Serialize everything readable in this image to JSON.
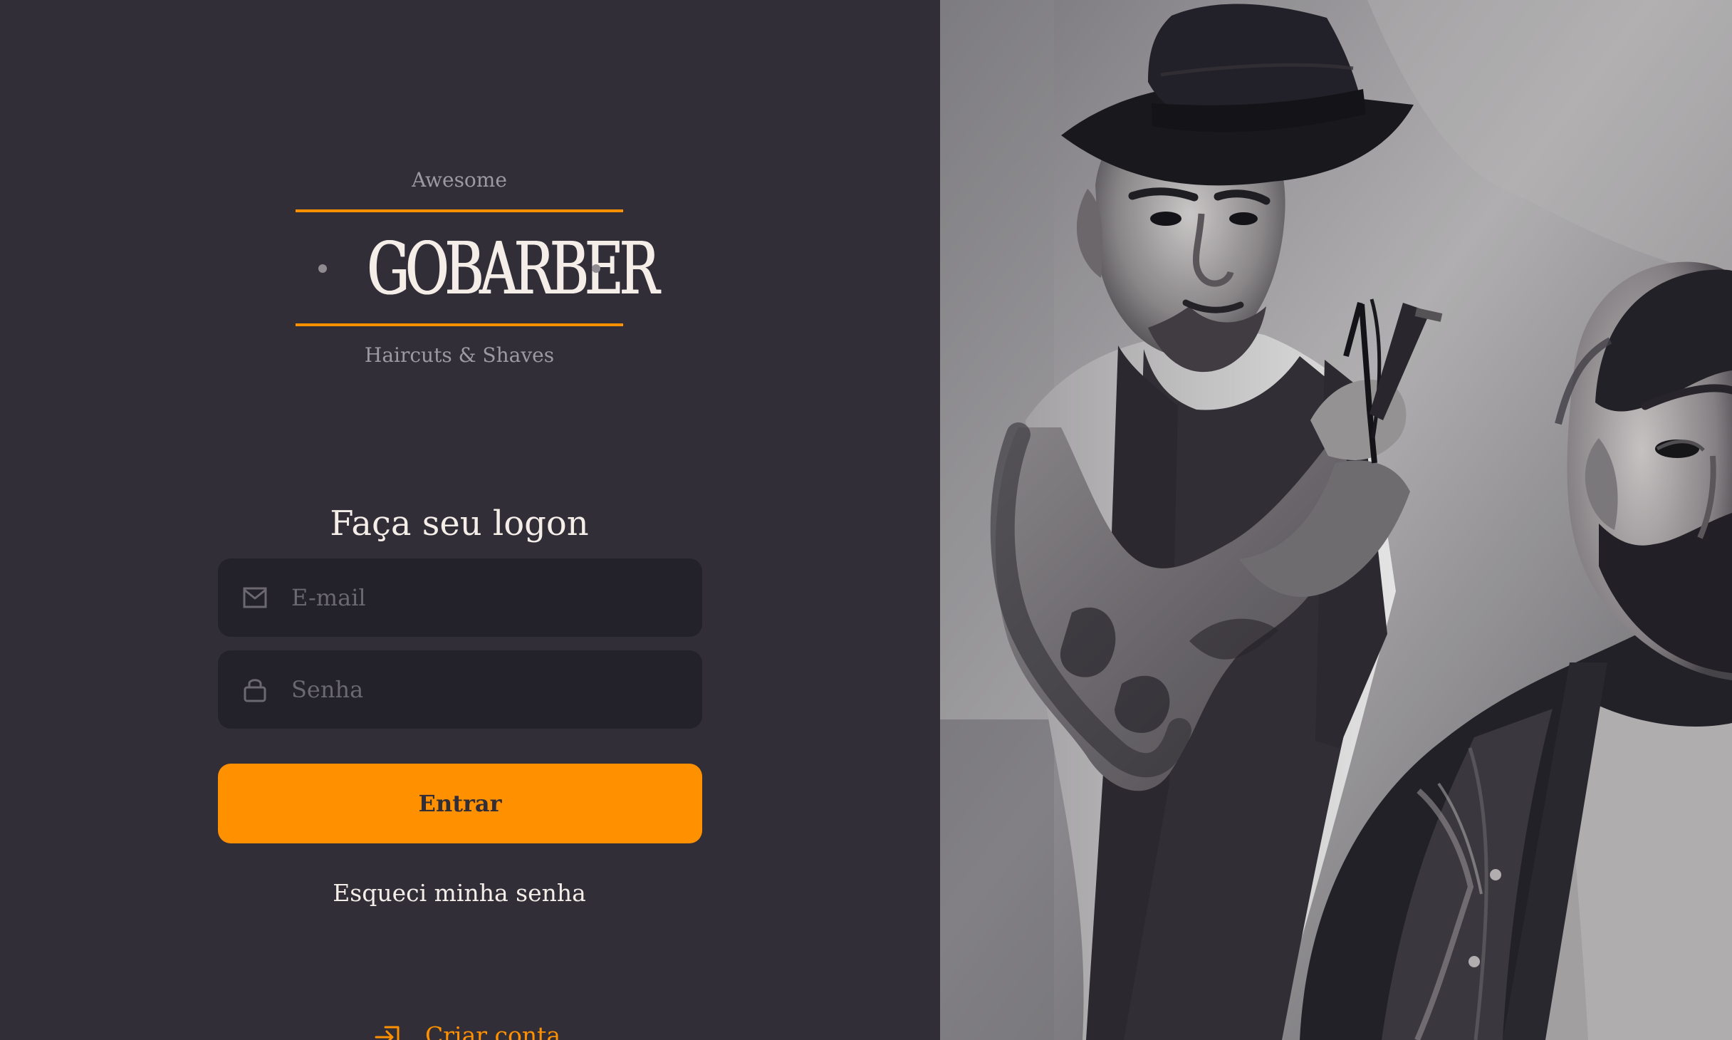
{
  "colors": {
    "background": "#312e38",
    "input_background": "#232129",
    "accent": "#ff9000",
    "text": "#f4ede8",
    "muted": "#9b9aa0",
    "placeholder": "#6b6870"
  },
  "brand": {
    "top_text": "Awesome",
    "name": "GOBARBER",
    "subtitle": "Haircuts & Shaves"
  },
  "form": {
    "title": "Faça seu logon",
    "email": {
      "value": "",
      "placeholder": "E-mail",
      "icon": "mail-icon"
    },
    "password": {
      "value": "",
      "placeholder": "Senha",
      "icon": "lock-icon"
    },
    "submit_label": "Entrar",
    "forgot_password_label": "Esqueci minha senha",
    "create_account_label": "Criar conta",
    "create_account_icon": "log-in-icon"
  },
  "hero_image": {
    "description": "black-and-white photograph of a barber cutting a customer's hair"
  }
}
